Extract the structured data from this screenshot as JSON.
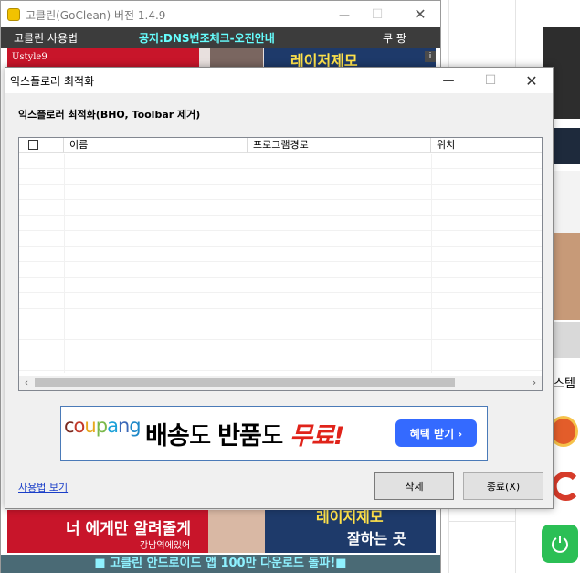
{
  "main_window": {
    "title": "고클린(GoClean) 버전 1.4.9",
    "menu_left": "고클린 사용법",
    "notice": "공지:DNS변조체크-오진안내",
    "menu_right": "쿠 팡",
    "top_banner_small": "Ustyle9",
    "top_banner_big": "레이저제모",
    "bottom_banner_text": "너 에게만 알려줄게",
    "bottom_banner_sub": "강남역에있어",
    "bottom_banner_right1": "레이저제모",
    "bottom_banner_right2": "잘하는 곳",
    "footer": "■ 고클린 안드로이드 앱 100만 다운로드 돌파!■"
  },
  "dialog": {
    "title": "익스플로러 최적화",
    "heading": "익스플로러 최적화(BHO, Toolbar 제거)",
    "columns": [
      "이름",
      "프로그램경로",
      "위치"
    ],
    "ad": {
      "brand": "coupang",
      "slogan_a": "배송",
      "slogan_b": "도 ",
      "slogan_c": "반품",
      "slogan_d": "도 ",
      "slogan_e": "무료!",
      "cta": "혜택 받기 ›"
    },
    "help_link": "사용법 보기",
    "delete_button": "삭제",
    "close_button": "종료(X)"
  },
  "background": {
    "side_text": "스템"
  },
  "colors": {
    "menubar": "#3c3c3c",
    "notice": "#66ffff",
    "footer_bg": "#4a6a75",
    "coupang_red": "#e0231a",
    "cta_blue": "#346aff"
  }
}
